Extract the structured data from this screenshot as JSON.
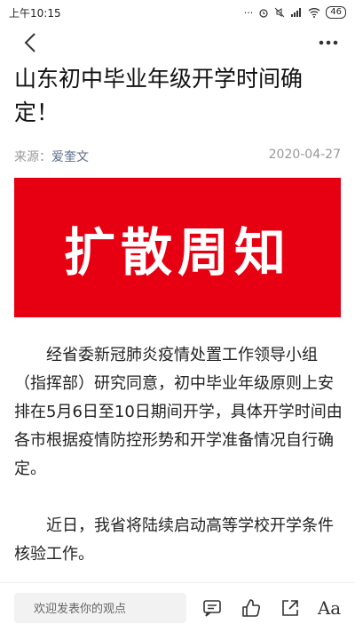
{
  "status_bar": {
    "time": "上午10:15",
    "network": "46",
    "icons": [
      "dots-icon",
      "alarm-icon",
      "mute-icon",
      "signal-icon",
      "wifi-icon",
      "battery-icon"
    ]
  },
  "nav": {
    "back_icon": "chevron-left-icon",
    "more_icon": "more-horizontal-icon"
  },
  "article": {
    "title": "山东初中毕业年级开学时间确定！",
    "source_label": "来源：",
    "source_name": "爱奎文",
    "date": "2020-04-27",
    "banner_text": "扩散周知",
    "paragraphs": [
      "经省委新冠肺炎疫情处置工作领导小组（指挥部）研究同意，初中毕业年级原则上安排在5月6日至10日期间开学，具体开学时间由各市根据疫情防控形势和开学准备情况自行确定。",
      "近日，我省将陆续启动高等学校开学条件核验工作。"
    ]
  },
  "bottom_bar": {
    "comment_placeholder": "欢迎发表你的观点",
    "icons": [
      "comment-icon",
      "like-icon",
      "share-icon",
      "font-size-icon"
    ],
    "font_label": "Aa"
  },
  "colors": {
    "banner": "#e60012",
    "source_name": "#5a6b8a",
    "meta": "#999999"
  }
}
